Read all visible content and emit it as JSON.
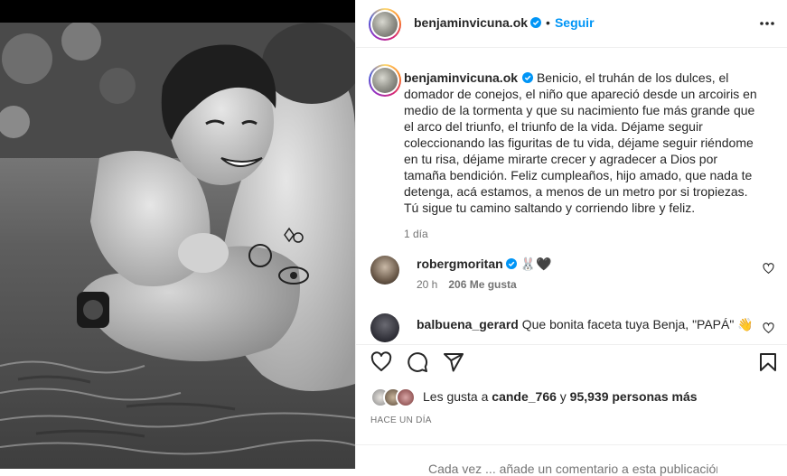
{
  "post": {
    "username": "benjaminvicuna.ok",
    "follow_label": "Seguir",
    "dot": "•"
  },
  "caption": {
    "username": "benjaminvicuna.ok",
    "text": "Benicio, el truhán de los dulces, el domador de conejos, el niño que apareció desde un arcoiris en medio de la tormenta y que su nacimiento fue más grande que el arco del triunfo, el triunfo de la vida. Déjame seguir coleccionando las figuritas de tu vida, déjame seguir riéndome en tu risa, déjame mirarte crecer y agradecer a Dios por tamaña bendición. Feliz cumpleaños, hijo amado, que nada te detenga, acá estamos, a menos de un metro por si tropiezas. Tú sigue tu camino saltando y corriendo libre y feliz.",
    "time": "1 día"
  },
  "comments": [
    {
      "username": "robergmoritan",
      "text": "🐰🖤",
      "time": "20 h",
      "likes": "206 Me gusta"
    },
    {
      "username": "balbuena_gerard",
      "text": "Que bonita faceta tuya Benja, \"PAPÁ\" 👋"
    }
  ],
  "likes": {
    "prefix": "Les gusta a ",
    "user": "cande_766",
    "connector": " y ",
    "count": "95,939 personas más"
  },
  "timeago": "HACE UN DÍA",
  "add_comment": {
    "placeholder": "Cada vez ... añade un comentario a esta publicación"
  },
  "colors": {
    "accent": "#0095f6",
    "text": "#262626",
    "muted": "#737373"
  },
  "icons": [
    "verified-badge-icon",
    "more-options-icon",
    "heart-icon",
    "comment-icon",
    "share-icon",
    "bookmark-icon"
  ]
}
